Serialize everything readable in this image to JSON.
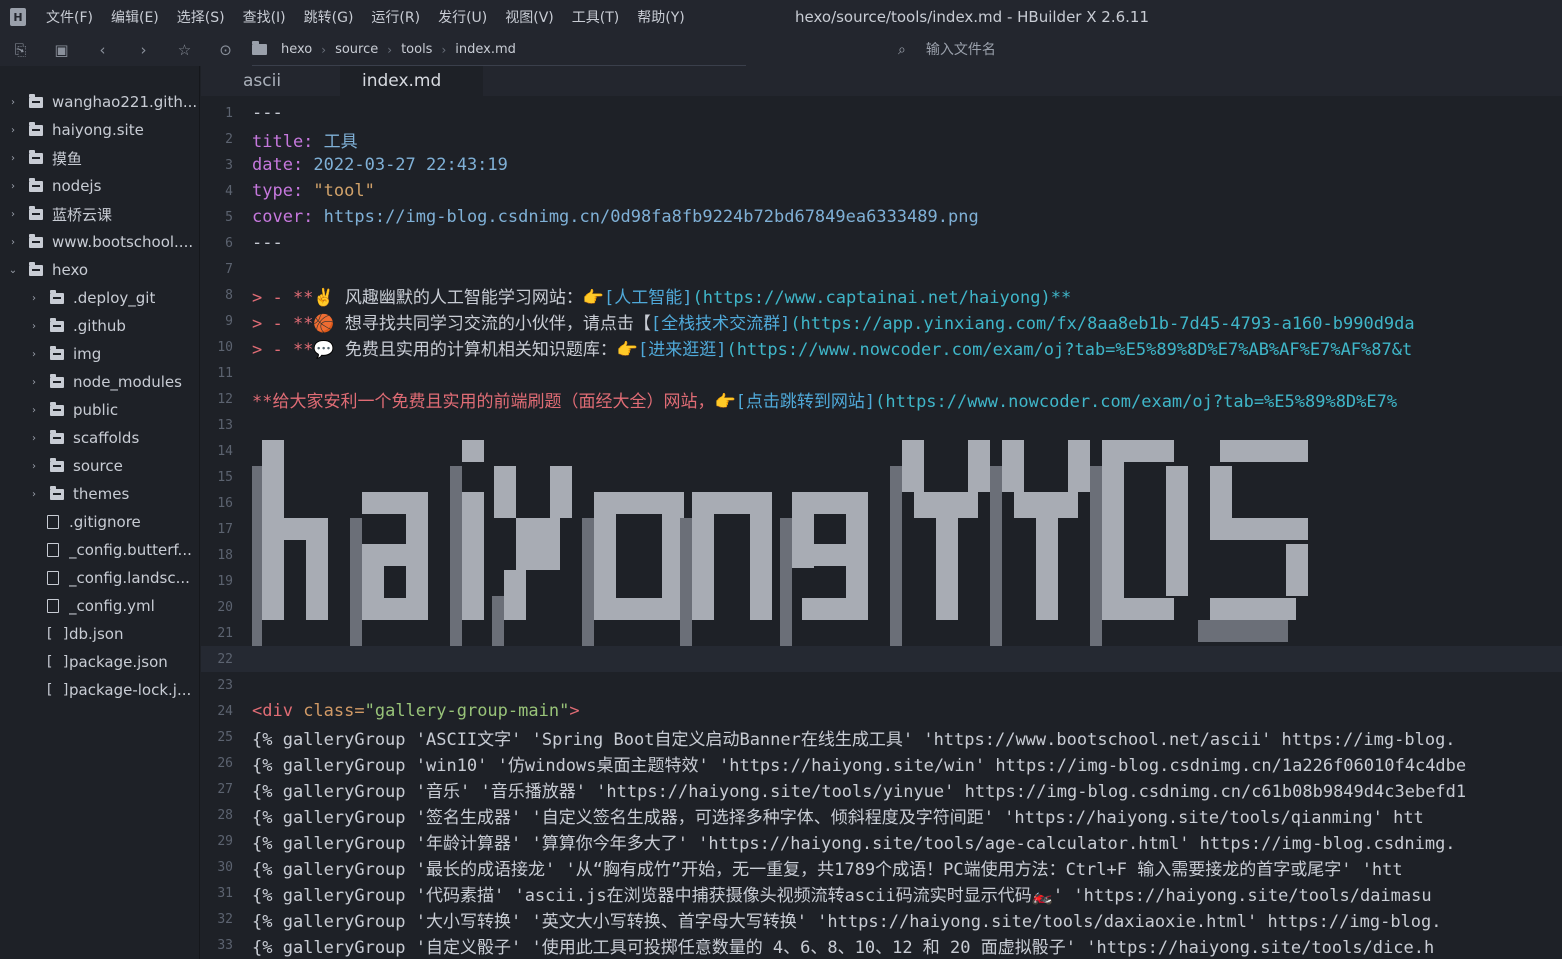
{
  "menubar": {
    "items": [
      "文件(F)",
      "编辑(E)",
      "选择(S)",
      "查找(I)",
      "跳转(G)",
      "运行(R)",
      "发行(U)",
      "视图(V)",
      "工具(T)",
      "帮助(Y)"
    ],
    "title": "hexo/source/tools/index.md - HBuilder X 2.6.11"
  },
  "toolbar": {
    "breadcrumb": [
      "hexo",
      "source",
      "tools",
      "index.md"
    ],
    "file_search_placeholder": "输入文件名"
  },
  "sidebar": {
    "items": [
      {
        "label": "wanghao221.gith...",
        "kind": "folder",
        "expanded": false,
        "depth": 0
      },
      {
        "label": "haiyong.site",
        "kind": "folder",
        "expanded": false,
        "depth": 0
      },
      {
        "label": "摸鱼",
        "kind": "folder",
        "expanded": false,
        "depth": 0
      },
      {
        "label": "nodejs",
        "kind": "folder",
        "expanded": false,
        "depth": 0
      },
      {
        "label": "蓝桥云课",
        "kind": "folder",
        "expanded": false,
        "depth": 0
      },
      {
        "label": "www.bootschool....",
        "kind": "folder",
        "expanded": false,
        "depth": 0
      },
      {
        "label": "hexo",
        "kind": "folder",
        "expanded": true,
        "depth": 0
      },
      {
        "label": ".deploy_git",
        "kind": "folder",
        "expanded": false,
        "depth": 1
      },
      {
        "label": ".github",
        "kind": "folder",
        "expanded": false,
        "depth": 1
      },
      {
        "label": "img",
        "kind": "folder",
        "expanded": false,
        "depth": 1
      },
      {
        "label": "node_modules",
        "kind": "folder",
        "expanded": false,
        "depth": 1
      },
      {
        "label": "public",
        "kind": "folder",
        "expanded": false,
        "depth": 1
      },
      {
        "label": "scaffolds",
        "kind": "folder",
        "expanded": false,
        "depth": 1
      },
      {
        "label": "source",
        "kind": "folder",
        "expanded": false,
        "depth": 1
      },
      {
        "label": "themes",
        "kind": "folder",
        "expanded": false,
        "depth": 1
      },
      {
        "label": ".gitignore",
        "kind": "file",
        "depth": 1
      },
      {
        "label": "_config.butterf...",
        "kind": "file",
        "depth": 1
      },
      {
        "label": "_config.landsc...",
        "kind": "file",
        "depth": 1
      },
      {
        "label": "_config.yml",
        "kind": "file",
        "depth": 1
      },
      {
        "label": "db.json",
        "kind": "json",
        "depth": 1
      },
      {
        "label": "package.json",
        "kind": "json",
        "depth": 1
      },
      {
        "label": "package-lock.j...",
        "kind": "json",
        "depth": 1
      }
    ]
  },
  "tabs": [
    {
      "label": "ascii",
      "active": false
    },
    {
      "label": "index.md",
      "active": true
    }
  ],
  "editor": {
    "line_numbers": [
      "1",
      "2",
      "3",
      "4",
      "5",
      "6",
      "7",
      "8",
      "9",
      "10",
      "11",
      "12",
      "13",
      "14",
      "15",
      "16",
      "17",
      "18",
      "19",
      "20",
      "21",
      "22",
      "23",
      "24",
      "25",
      "26",
      "27",
      "28",
      "29",
      "30",
      "31",
      "32",
      "33"
    ],
    "front_matter": {
      "open": "---",
      "title_key": "title:",
      "title_val": " 工具",
      "date_key": "date:",
      "date_val": " 2022-03-27 22:43:19",
      "type_key": "type:",
      "type_val": " \"tool\"",
      "cover_key": "cover:",
      "cover_val": " https://img-blog.csdnimg.cn/0d98fa8fb9224b72bd67849ea6333489.png",
      "close": "---"
    },
    "quote_lines": [
      {
        "prefix": "> - **",
        "emoji": "✌️",
        "text": " 风趣幽默的人工智能学习网站：",
        "hand": "👉",
        "link_text": "[人工智能]",
        "url": "(https://www.captainai.net/haiyong)**"
      },
      {
        "prefix": "> - **",
        "emoji": "🏀",
        "text": " 想寻找共同学习交流的小伙伴，请点击【",
        "hand": "",
        "link_text": "[全栈技术交流群]",
        "url": "(https://app.yinxiang.com/fx/8aa8eb1b-7d45-4793-a160-b990d9da"
      },
      {
        "prefix": "> - **",
        "emoji": "💬",
        "text": " 免费且实用的计算机相关知识题库：",
        "hand": "👉",
        "link_text": "[进来逛逛]",
        "url": "(https://www.nowcoder.com/exam/oj?tab=%E5%89%8D%E7%AB%AF%E7%AF%87&t"
      }
    ],
    "bold_line": {
      "text": "**给大家安利一个免费且实用的前端刷题（面经大全）网站，",
      "hand": "👉",
      "link_text": "[点击跳转到网站]",
      "url": "(https://www.nowcoder.com/exam/oj?tab=%E5%89%8D%E7%"
    },
    "div_line": {
      "open": "<div",
      "attr": " class=",
      "val": "\"gallery-group-main\"",
      "close": ">"
    },
    "gallery_lines": [
      "{% galleryGroup 'ASCII文字' 'Spring Boot自定义启动Banner在线生成工具' 'https://www.bootschool.net/ascii' https://img-blog.",
      "{% galleryGroup 'win10' '仿windows桌面主题特效' 'https://haiyong.site/win' https://img-blog.csdnimg.cn/1a226f06010f4c4dbe",
      "{% galleryGroup '音乐' '音乐播放器' 'https://haiyong.site/tools/yinyue' https://img-blog.csdnimg.cn/c61b08b9849d4c3ebefd1",
      "{% galleryGroup '签名生成器' '自定义签名生成器，可选择多种字体、倾斜程度及字符间距' 'https://haiyong.site/tools/qianming' htt",
      "{% galleryGroup '年龄计算器' '算算你今年多大了' 'https://haiyong.site/tools/age-calculator.html' https://img-blog.csdnimg.",
      "{% galleryGroup '最长的成语接龙' '从“胸有成竹”开始，无一重复，共1789个成语！PC端使用方法：Ctrl+F 输入需要接龙的首字或尾字' 'htt",
      "{% galleryGroup '代码素描' 'ascii.js在浏览器中捕获摄像头视频流转ascii码流实时显示代码🏍️' 'https://haiyong.site/tools/daimasu",
      "{% galleryGroup '大小写转换' '英文大小写转换、首字母大写转换' 'https://haiyong.site/tools/daxiaoxie.html' https://img-blog.",
      "{% galleryGroup '自定义骰子' '使用此工具可投掷任意数量的 4、6、8、10、12 和 20 面虚拟骰子' 'https://haiyong.site/tools/dice.h"
    ]
  }
}
